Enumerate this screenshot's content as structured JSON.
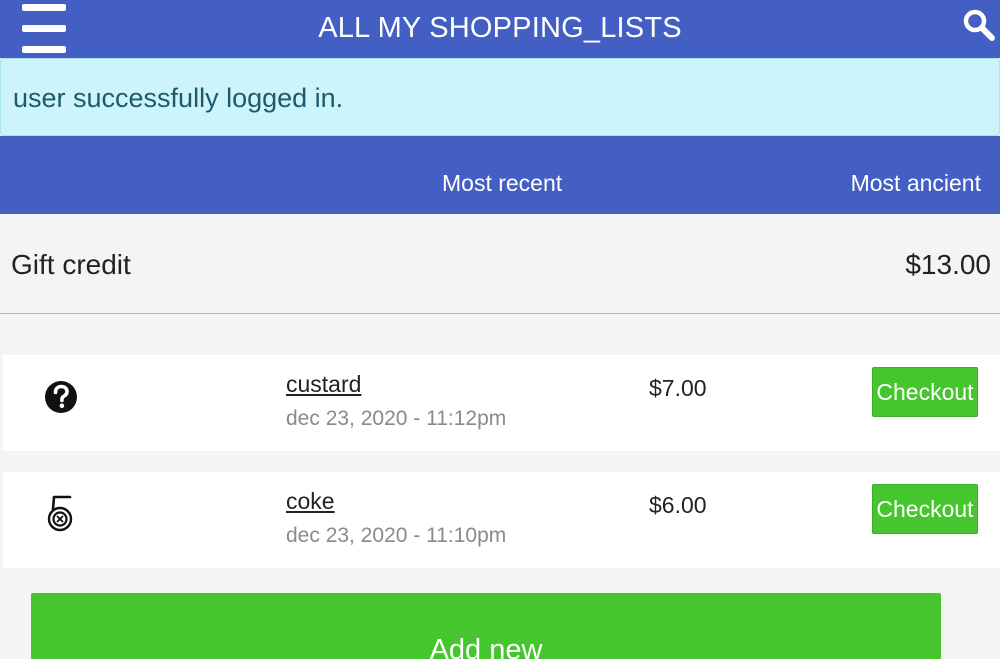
{
  "header": {
    "title": "ALL MY SHOPPING_LISTS",
    "menu_icon": "hamburger-menu-icon",
    "search_icon": "search-icon"
  },
  "alert": {
    "message": "user successfully logged in."
  },
  "sort": {
    "recent_label": "Most recent",
    "ancient_label": "Most ancient"
  },
  "credit": {
    "label": "Gift credit",
    "value": "$13.00"
  },
  "lists": [
    {
      "icon": "question-circle-icon",
      "name": "custard",
      "date": "dec 23, 2020 - 11:12pm",
      "price": "$7.00",
      "action_label": "Checkout"
    },
    {
      "icon": "five-logo-icon",
      "name": "coke",
      "date": "dec 23, 2020 - 11:10pm",
      "price": "$6.00",
      "action_label": "Checkout"
    }
  ],
  "add_button": {
    "label": "Add new"
  },
  "colors": {
    "primary": "#445fc4",
    "alert_bg": "#cdf3fb",
    "alert_text": "#1e5a6a",
    "success": "#45c62e"
  }
}
